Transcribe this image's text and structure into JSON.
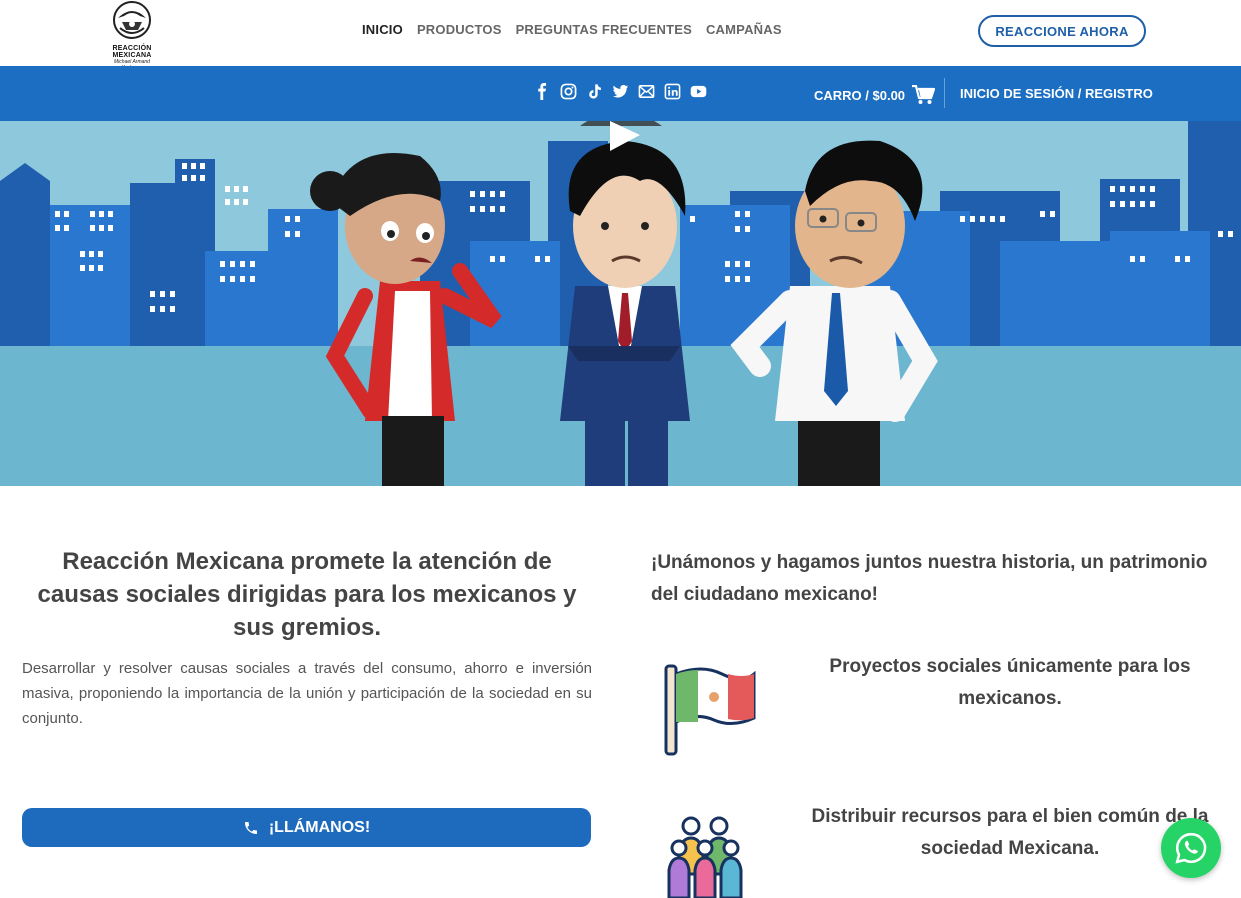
{
  "logo": {
    "line1": "REACCIÓN",
    "line2": "MEXICANA",
    "signature": "Michael Armand Yapburgo"
  },
  "nav": {
    "items": [
      {
        "label": "INICIO",
        "active": true
      },
      {
        "label": "PRODUCTOS",
        "active": false
      },
      {
        "label": "PREGUNTAS FRECUENTES",
        "active": false
      },
      {
        "label": "CAMPAÑAS",
        "active": false
      }
    ],
    "cta": "REACCIONE AHORA"
  },
  "subbar": {
    "social_icons": [
      "facebook-icon",
      "instagram-icon",
      "tiktok-icon",
      "twitter-icon",
      "email-icon",
      "linkedin-icon",
      "youtube-icon"
    ],
    "cart": "CARRO / $0.00",
    "login": "INICIO DE SESIÓN / REGISTRO"
  },
  "hero": {
    "video": "play-icon"
  },
  "left": {
    "title": "Reacción Mexicana promete la atención de causas sociales dirigidas para los mexicanos y sus gremios.",
    "text": "Desarrollar y resolver causas sociales a través del consumo, ahorro e inversión masiva, proponiendo la importancia de la unión y participación de la sociedad en su conjunto.",
    "button": "¡LLÁMANOS!"
  },
  "right": {
    "intro": "¡Unámonos y hagamos juntos nuestra historia, un patrimonio del ciudadano mexicano!",
    "features": [
      {
        "icon": "mexico-flag-icon",
        "text": "Proyectos sociales únicamente para los mexicanos."
      },
      {
        "icon": "people-group-icon",
        "text": "Distribuir recursos para el bien común de la sociedad Mexicana."
      }
    ]
  },
  "colors": {
    "primary": "#1b6ec2",
    "button": "#1e6bbd",
    "whatsapp": "#25d366",
    "text": "#444444"
  },
  "whatsapp": "whatsapp-icon"
}
